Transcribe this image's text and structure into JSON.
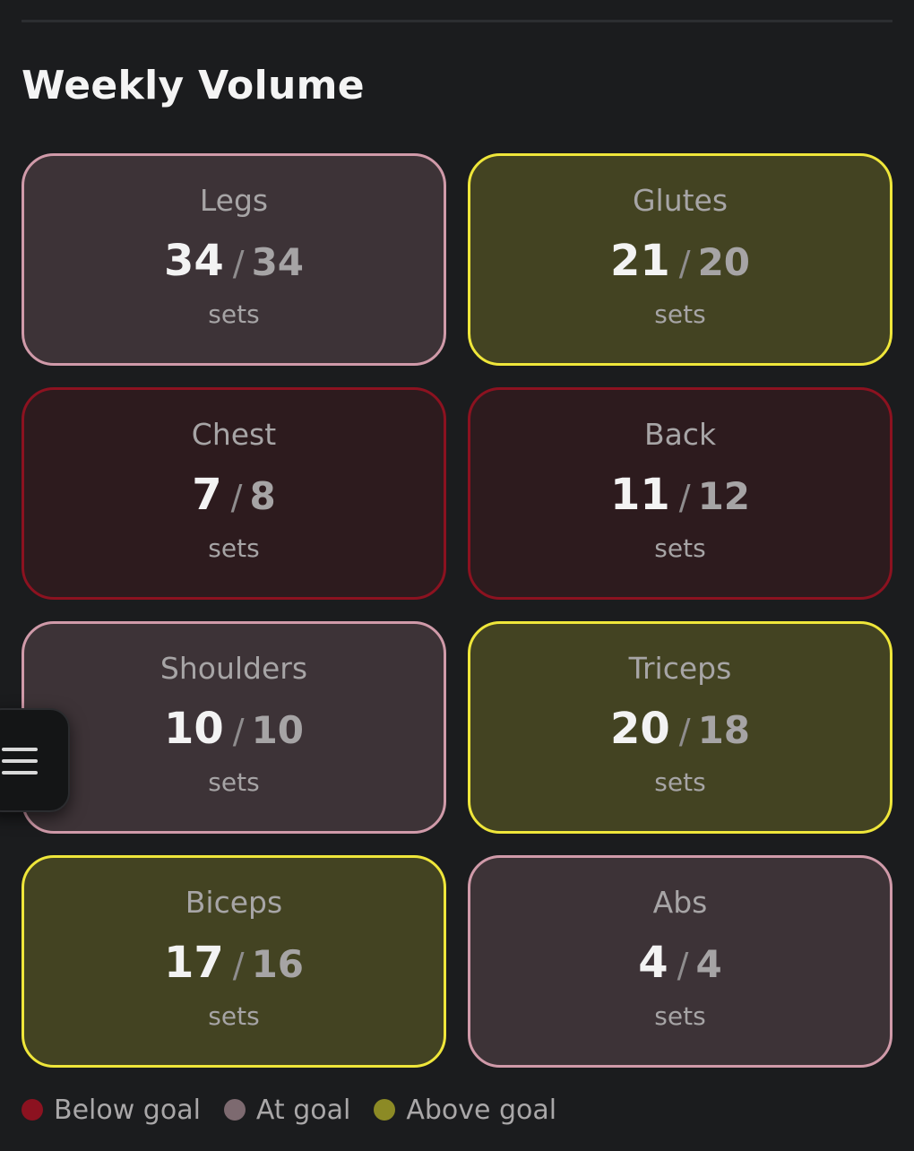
{
  "title": "Weekly Volume",
  "cards": [
    {
      "name": "Legs",
      "current": "34",
      "separator": "/",
      "goal": "34",
      "unit": "sets",
      "status": "at"
    },
    {
      "name": "Glutes",
      "current": "21",
      "separator": "/",
      "goal": "20",
      "unit": "sets",
      "status": "above"
    },
    {
      "name": "Chest",
      "current": "7",
      "separator": "/",
      "goal": "8",
      "unit": "sets",
      "status": "below"
    },
    {
      "name": "Back",
      "current": "11",
      "separator": "/",
      "goal": "12",
      "unit": "sets",
      "status": "below"
    },
    {
      "name": "Shoulders",
      "current": "10",
      "separator": "/",
      "goal": "10",
      "unit": "sets",
      "status": "at"
    },
    {
      "name": "Triceps",
      "current": "20",
      "separator": "/",
      "goal": "18",
      "unit": "sets",
      "status": "above"
    },
    {
      "name": "Biceps",
      "current": "17",
      "separator": "/",
      "goal": "16",
      "unit": "sets",
      "status": "above"
    },
    {
      "name": "Abs",
      "current": "4",
      "separator": "/",
      "goal": "4",
      "unit": "sets",
      "status": "at"
    }
  ],
  "legend": [
    {
      "label": "Below goal",
      "color": "#8c1220"
    },
    {
      "label": "At goal",
      "color": "#7d6a70"
    },
    {
      "label": "Above goal",
      "color": "#8c8a25"
    }
  ],
  "status_colors": {
    "below": {
      "bg": "#2d1b1e",
      "border": "#8c1220"
    },
    "at": {
      "bg": "#3d3337",
      "border": "#d09aa9"
    },
    "above": {
      "bg": "#434322",
      "border": "#efe63a"
    }
  },
  "menu_button": {
    "icon": "hamburger-menu-icon"
  }
}
